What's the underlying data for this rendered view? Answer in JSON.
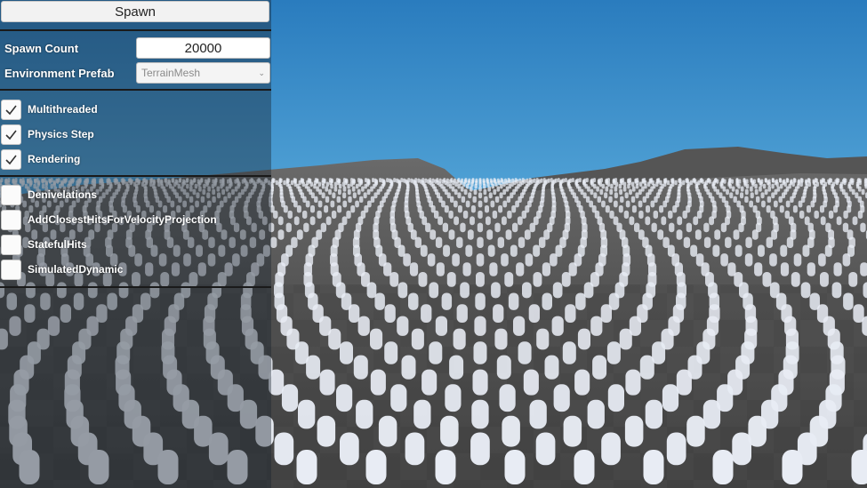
{
  "toolbar": {
    "spawn_label": "Spawn"
  },
  "settings": {
    "spawn_count_label": "Spawn Count",
    "spawn_count_value": "20000",
    "environment_label": "Environment Prefab",
    "environment_value": "TerrainMesh"
  },
  "toggles": [
    {
      "label": "Multithreaded",
      "checked": true
    },
    {
      "label": "Physics Step",
      "checked": true
    },
    {
      "label": "Rendering",
      "checked": true
    }
  ],
  "options": [
    {
      "label": "Denivelations",
      "checked": false
    },
    {
      "label": "AddClosestHitsForVelocityProjection",
      "checked": false
    },
    {
      "label": "StatefulHits",
      "checked": false
    },
    {
      "label": "SimulatedDynamic",
      "checked": false
    }
  ],
  "colors": {
    "sky_top": "#2d7fbf",
    "sky_horizon": "#8fd0ef",
    "ground": "#4a4a4a",
    "character": "#e8ecf4"
  }
}
